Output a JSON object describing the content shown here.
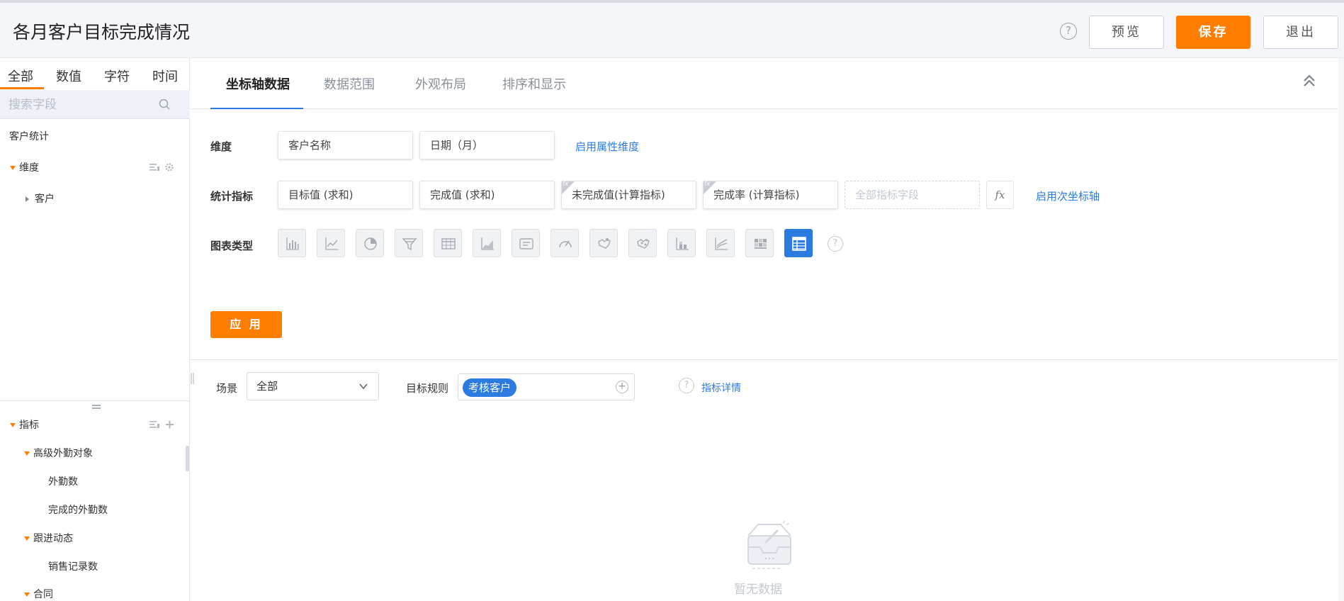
{
  "header": {
    "title": "各月客户目标完成情况",
    "help": "?",
    "preview_label": "预览",
    "save_label": "保存",
    "exit_label": "退出"
  },
  "sidebar": {
    "tabs": [
      "全部",
      "数值",
      "字符",
      "时间"
    ],
    "search_placeholder": "搜索字段",
    "dataset_title": "客户统计",
    "dimension_group": "维度",
    "dimension_items": [
      "客户"
    ],
    "metric_group": "指标",
    "metric_tree": [
      {
        "label": "高级外勤对象",
        "children": [
          "外勤数",
          "完成的外勤数"
        ]
      },
      {
        "label": "跟进动态",
        "children": [
          "销售记录数"
        ]
      },
      {
        "label": "合同",
        "children": []
      }
    ]
  },
  "main": {
    "tabs": [
      "坐标轴数据",
      "数据范围",
      "外观布局",
      "排序和显示"
    ],
    "dimension_label": "维度",
    "dimension_fields": [
      "客户名称",
      "日期（月）"
    ],
    "dimension_link": "启用属性维度",
    "metric_label": "统计指标",
    "metric_fields": [
      "目标值 (求和)",
      "完成值 (求和)",
      "未完成值(计算指标)",
      "完成率 (计算指标)"
    ],
    "metric_placeholder": "全部指标字段",
    "fx_label": "fx",
    "metric_link": "启用次坐标轴",
    "chart_type_label": "图表类型",
    "chart_types": [
      "bar-chart-icon",
      "line-chart-icon",
      "pie-chart-icon",
      "funnel-chart-icon",
      "table-icon",
      "area-chart-icon",
      "kpi-card-icon",
      "gauge-icon",
      "map-icon",
      "scatter-map-icon",
      "stacked-bar-icon",
      "combo-chart-icon",
      "heatmap-icon",
      "pivot-table-icon"
    ],
    "chart_type_selected": "pivot-table-icon",
    "apply_label": "应 用",
    "scene_label": "场景",
    "scene_value": "全部",
    "rule_label": "目标规则",
    "rule_tag": "考核客户",
    "detail_link": "指标详情",
    "empty_text": "暂无数据"
  },
  "colors": {
    "accent_orange": "#ff7d00",
    "accent_blue": "#2b7be0"
  }
}
